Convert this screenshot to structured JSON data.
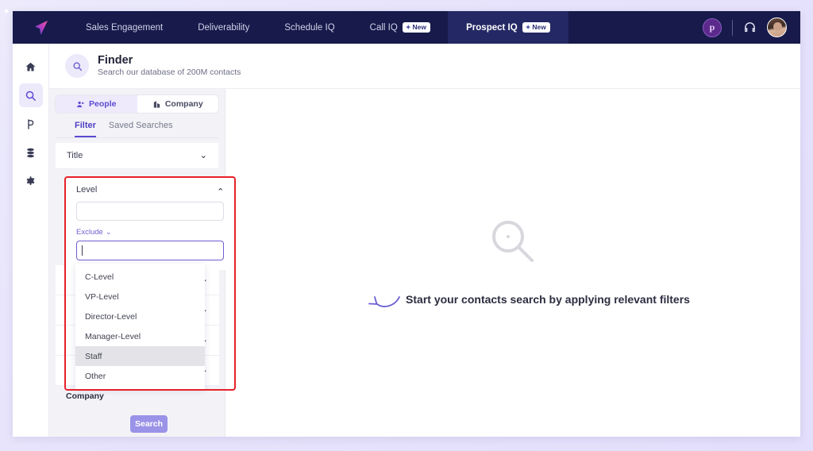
{
  "navbar": {
    "logo_icon": "paper-plane-logo",
    "items": [
      {
        "label": "Sales Engagement",
        "badge": null,
        "active": false
      },
      {
        "label": "Deliverability",
        "badge": null,
        "active": false
      },
      {
        "label": "Schedule IQ",
        "badge": null,
        "active": false
      },
      {
        "label": "Call IQ",
        "badge": "New",
        "active": false
      },
      {
        "label": "Prospect IQ",
        "badge": "New",
        "active": true
      }
    ],
    "product_circle_glyph": "p",
    "support_icon": "headset-icon",
    "avatar_icon": "user-avatar",
    "active_bg": "#242864",
    "bg": "#171a4a"
  },
  "rail": {
    "items": [
      {
        "name": "home",
        "glyph": "home-icon",
        "active": false
      },
      {
        "name": "search",
        "glyph": "search-icon",
        "active": true
      },
      {
        "name": "prospect",
        "glyph": "prospect-icon",
        "active": false
      },
      {
        "name": "database",
        "glyph": "database-icon",
        "active": false
      },
      {
        "name": "settings",
        "glyph": "gear-icon",
        "active": false
      }
    ],
    "active_bg": "#ece9fb",
    "active_color": "#5b4ad1"
  },
  "header": {
    "icon": "search-circle-icon",
    "title": "Finder",
    "subtitle": "Search our database of 200M contacts"
  },
  "sidebar": {
    "segments": [
      {
        "label": "People",
        "icon": "people-icon",
        "active": true
      },
      {
        "label": "Company",
        "icon": "building-icon",
        "active": false
      }
    ],
    "tabs": [
      {
        "label": "Filter",
        "active": true
      },
      {
        "label": "Saved Searches",
        "active": false
      }
    ],
    "filters_top": [
      {
        "label": "Title",
        "expanded": false
      }
    ],
    "level_filter": {
      "label": "Level",
      "expanded": true,
      "include_value": "",
      "exclude_label": "Exclude",
      "exclude_value": "",
      "options": [
        {
          "label": "C-Level",
          "hover": false
        },
        {
          "label": "VP-Level",
          "hover": false
        },
        {
          "label": "Director-Level",
          "hover": false
        },
        {
          "label": "Manager-Level",
          "hover": false
        },
        {
          "label": "Staff",
          "hover": true
        },
        {
          "label": "Other",
          "hover": false
        }
      ]
    },
    "collapsed_rows": [
      "",
      "",
      "",
      ""
    ],
    "company_label": "Company",
    "search_button": "Search",
    "search_button_color": "#9a93e8",
    "highlight_color": "#e8202a"
  },
  "main": {
    "empty_icon": "large-search-icon",
    "arrow_icon": "curved-arrow-icon",
    "empty_message": "Start your contacts search by applying relevant filters"
  }
}
